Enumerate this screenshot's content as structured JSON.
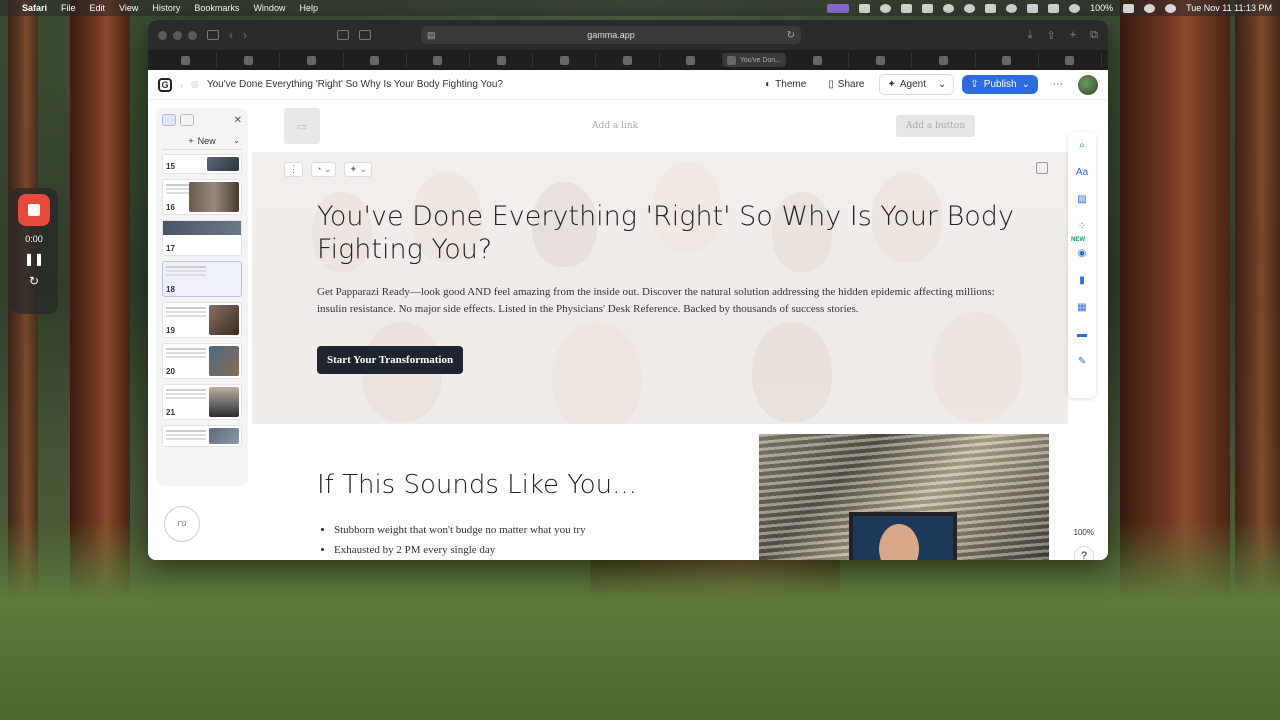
{
  "menubar": {
    "app": "Safari",
    "menus": [
      "File",
      "Edit",
      "View",
      "History",
      "Bookmarks",
      "Window",
      "Help"
    ],
    "battery": "100%",
    "clock": "Tue Nov 11  11:13 PM"
  },
  "browser": {
    "url": "gamma.app",
    "active_tab": "You've Don..."
  },
  "app": {
    "doc_title": "You've Done Everything 'Right' So Why Is Your Body Fighting You?",
    "theme_label": "Theme",
    "share_label": "Share",
    "agent_label": "Agent",
    "publish_label": "Publish"
  },
  "panel": {
    "new_label": "New",
    "slides": [
      {
        "num": "15"
      },
      {
        "num": "16"
      },
      {
        "num": "17"
      },
      {
        "num": "18"
      },
      {
        "num": "19"
      },
      {
        "num": "20"
      },
      {
        "num": "21"
      }
    ]
  },
  "recorder": {
    "time": "0:00"
  },
  "slide_header": {
    "add_link": "Add a link",
    "add_button": "Add a button"
  },
  "hero": {
    "title": "You've Done Everything 'Right' So Why Is Your Body Fighting You?",
    "subtitle": "Get Papparazi Ready—look good AND feel amazing from the inside out. Discover the natural solution addressing the hidden epidemic affecting millions: insulin resistance. No major side effects. Listed in the Physicians' Desk Reference. Backed by thousands of success stories.",
    "cta": "Start Your Transformation"
  },
  "rail": {
    "new_badge": "NEW",
    "zoom": "100%",
    "help": "?"
  },
  "slide2": {
    "title": "If This Sounds Like You...",
    "bullets": [
      "Stubborn weight that won't budge no matter what you try",
      "Exhausted by 2 PM every single day"
    ]
  },
  "colors": {
    "accent": "#2d6cdf",
    "cta_bg": "#1f2530",
    "record": "#e64a3a"
  }
}
